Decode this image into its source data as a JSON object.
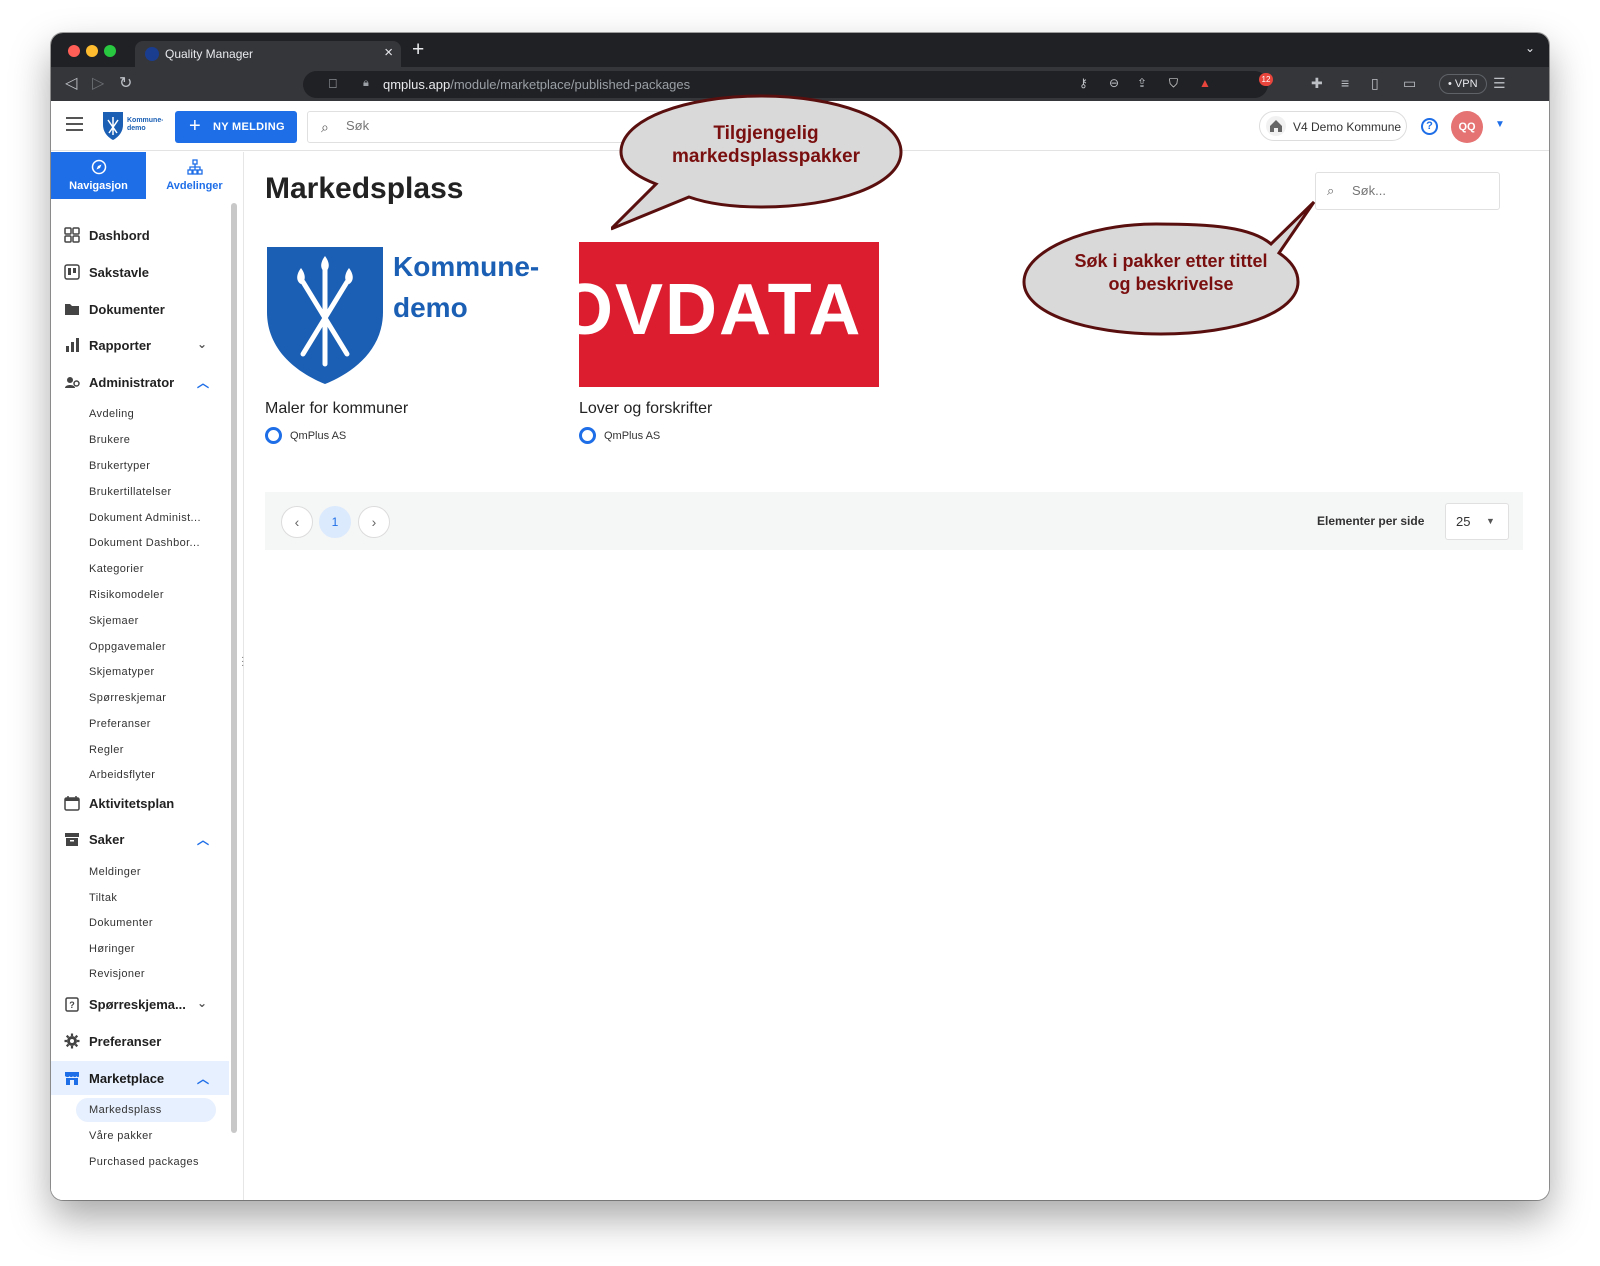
{
  "browser": {
    "tab_title": "Quality Manager",
    "tab_close": "×",
    "new_tab": "+",
    "tab_menu": "⌄",
    "url_domain": "qmplus.app",
    "url_path": "/module/marketplace/published-packages",
    "shield_badge": "12",
    "vpn_label": "• VPN"
  },
  "header": {
    "new_button_label": "NY MELDING",
    "search_placeholder": "Søk",
    "org_name": "V4 Demo Kommune",
    "avatar_initials": "QQ",
    "logo_text": "Kommune-demo"
  },
  "sidebar": {
    "tabs": [
      {
        "label": "Navigasjon",
        "active": true
      },
      {
        "label": "Avdelinger",
        "active": false
      }
    ],
    "items": {
      "dashboard": "Dashbord",
      "sakstavle": "Sakstavle",
      "dokumenter": "Dokumenter",
      "rapporter": "Rapporter",
      "administrator": "Administrator",
      "aktivitetsplan": "Aktivitetsplan",
      "saker": "Saker",
      "sporreskjema": "Spørreskjema...",
      "preferanser": "Preferanser",
      "marketplace": "Marketplace"
    },
    "admin_sub": [
      "Avdeling",
      "Brukere",
      "Brukertyper",
      "Brukertillatelser",
      "Dokument Administ...",
      "Dokument Dashbor...",
      "Kategorier",
      "Risikomodeler",
      "Skjemaer",
      "Oppgavemaler",
      "Skjematyper",
      "Spørreskjemar",
      "Preferanser",
      "Regler",
      "Arbeidsflyter"
    ],
    "saker_sub": [
      "Meldinger",
      "Tiltak",
      "Dokumenter",
      "Høringer",
      "Revisjoner"
    ],
    "marketplace_sub": [
      "Markedsplass",
      "Våre pakker",
      "Purchased packages"
    ]
  },
  "main": {
    "title": "Markedsplass",
    "search_placeholder": "Søk...",
    "packages": [
      {
        "name": "Maler for kommuner",
        "publisher": "QmPlus AS",
        "image_text_1": "Kommune-",
        "image_text_2": "demo"
      },
      {
        "name": "Lover og forskrifter",
        "publisher": "QmPlus AS",
        "image_text": "OVDATA"
      }
    ],
    "pagination": {
      "current_page": "1",
      "prev": "‹",
      "next": "›"
    },
    "per_page_label": "Elementer per side",
    "per_page_value": "25"
  },
  "annotations": {
    "callout_packages_line1": "Tilgjengelig",
    "callout_packages_line2": "markedsplasspakker",
    "callout_search_line1": "Søk i pakker etter tittel",
    "callout_search_line2": "og beskrivelse"
  },
  "colors": {
    "primary": "#1e6ee8",
    "lovdata_red": "#dc1d2f",
    "callout_fill": "#d9d9d9",
    "callout_border": "#5a0f0f",
    "callout_text": "#7a0f0f"
  }
}
